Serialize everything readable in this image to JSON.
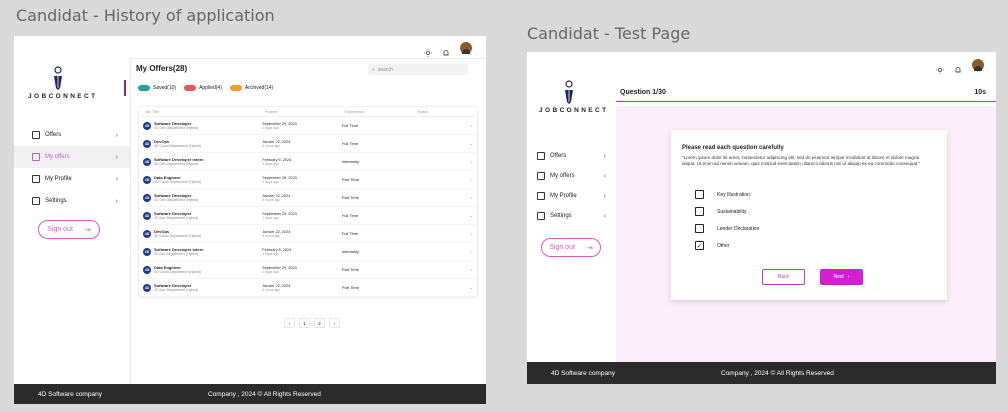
{
  "canvas": {
    "title_a": "Candidat - History of application",
    "title_b": "Candidat - Test Page"
  },
  "brand": {
    "logo_word": "JOBCONNECT"
  },
  "sidebar": {
    "items": [
      {
        "label": "Offers",
        "icon": "offers-icon"
      },
      {
        "label": "My offers",
        "icon": "people-icon"
      },
      {
        "label": "My Profile",
        "icon": "profile-icon"
      },
      {
        "label": "Settings",
        "icon": "settings-icon"
      }
    ],
    "signout_label": "Sign out"
  },
  "topbar": {
    "icons": [
      "sun-icon",
      "bell-icon",
      "avatar"
    ]
  },
  "history": {
    "title": "My Offers(28)",
    "search_placeholder": "search",
    "tabs": [
      {
        "label": "Saved(10)",
        "color": "#22a39a"
      },
      {
        "label": "Applied(4)",
        "color": "#e45a5a"
      },
      {
        "label": "Archived(14)",
        "color": "#f0a030"
      }
    ],
    "columns": [
      "Job Title",
      "Posted",
      "Experience",
      "Status"
    ],
    "rows": [
      {
        "title": "Software Developer",
        "sub": "4D Dev Department (Hybrid)",
        "date": "September 25, 2023",
        "ago": "2 days ago",
        "exp": "Full Time"
      },
      {
        "title": "DevOps",
        "sub": "4D Cloud Department (Hybrid)",
        "date": "Janvier 22, 2024",
        "ago": "5 hours ago",
        "exp": "Full Time"
      },
      {
        "title": "Software Developer Intern",
        "sub": "4D Dev Department (Hybrid)",
        "date": "February 5, 2024",
        "ago": "4 days ago",
        "exp": "Internship"
      },
      {
        "title": "Data Engineer",
        "sub": "4D Cloud Department (Hybrid)",
        "date": "September 25, 2023",
        "ago": "2 days ago",
        "exp": "Part Time"
      },
      {
        "title": "Software Developer",
        "sub": "4D Dev Department (Hybrid)",
        "date": "Janvier 22, 2024",
        "ago": "5 hours ago",
        "exp": "Part Time"
      },
      {
        "title": "Software Developer",
        "sub": "4D Dev Department (Hybrid)",
        "date": "September 25, 2023",
        "ago": "2 days ago",
        "exp": "Full Time"
      },
      {
        "title": "DevOps",
        "sub": "4D Cloud Department (Hybrid)",
        "date": "Janvier 22, 2024",
        "ago": "5 hours ago",
        "exp": "Full Time"
      },
      {
        "title": "Software Developer Intern",
        "sub": "4D Dev Department (Hybrid)",
        "date": "February 5, 2024",
        "ago": "4 days ago",
        "exp": "Internship"
      },
      {
        "title": "Data Engineer",
        "sub": "4D Cloud Department (Hybrid)",
        "date": "September 25, 2023",
        "ago": "2 days ago",
        "exp": "Part Time"
      },
      {
        "title": "Software Developer",
        "sub": "4D Dev Department (Hybrid)",
        "date": "Janvier 22, 2024",
        "ago": "5 hours ago",
        "exp": "Part Time"
      }
    ],
    "pager": {
      "prev": "‹",
      "pages": [
        "1",
        "2"
      ],
      "next": "›"
    }
  },
  "test": {
    "question_label": "Question 1/30",
    "timer": "10s",
    "card_title": "Please read each question carefully",
    "card_desc": "\"Lorem ipsum dolor sit amet, consectetur adipiscing elit, sed do eiusmod tempor incididunt ut labore et dolore magna aliqua. Ut enim ad minim veniam, quis nostrud exercitation ullamco laboris nisi ut aliquip ex ea commodo consequat.\"",
    "options": [
      {
        "label": "Key Illustration",
        "checked": false
      },
      {
        "label": "Sustainability",
        "checked": false
      },
      {
        "label": "Lender Declaration",
        "checked": false
      },
      {
        "label": "Other",
        "checked": true
      }
    ],
    "back_label": "Back",
    "next_label": "Next"
  },
  "footer": {
    "company": "4D Software company",
    "copyright": "Company , 2024 © All Rights Reserved"
  }
}
